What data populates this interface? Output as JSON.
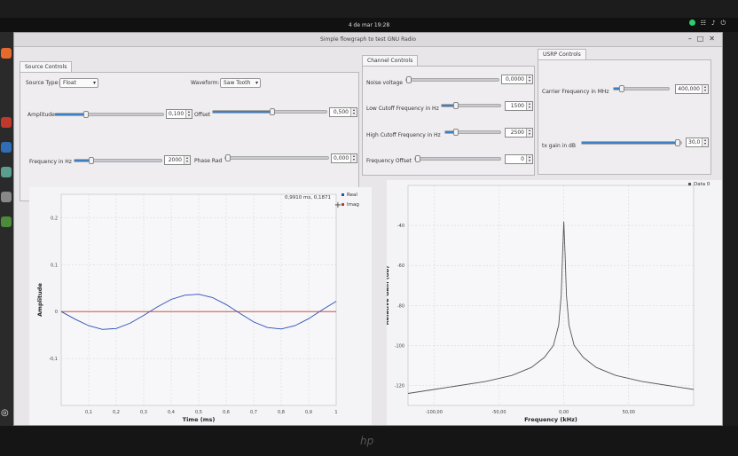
{
  "topbar": {
    "datetime": "4 de mar  19:28"
  },
  "window": {
    "title": "Simple flowgraph to test GNU Radio"
  },
  "source_controls": {
    "tab": "Source Controls",
    "source_type_label": "Source Type:",
    "source_type_value": "Float",
    "waveform_label": "Waveform:",
    "waveform_value": "Saw Tooth",
    "amplitude_label": "Amplitude",
    "amplitude_value": "0,100",
    "offset_label": "Offset",
    "offset_value": "0,500",
    "frequency_label": "Frequency in Hz",
    "frequency_value": "2000",
    "phase_label": "Phase Rad",
    "phase_value": "0,000"
  },
  "channel_controls": {
    "tab": "Channel Controls",
    "noise_label": "Noise voltage",
    "noise_value": "0,0000",
    "low_cutoff_label": "Low Cutoff Frequency in Hz",
    "low_cutoff_value": "1500",
    "high_cutoff_label": "High Cutoff Frequency in Hz",
    "high_cutoff_value": "2500",
    "freq_offset_label": "Frequency Offset",
    "freq_offset_value": "0"
  },
  "usrp_controls": {
    "tab": "USRP Controls",
    "carrier_label": "Carrier Frequency in MHz",
    "carrier_value": "400,000",
    "tx_gain_label": "tx gain in dB",
    "tx_gain_value": "30,0"
  },
  "colors": {
    "accent": "#3d7fc4",
    "real": "#2a4db8",
    "imag": "#c0392b"
  },
  "chart_data": [
    {
      "type": "line",
      "xlabel": "Time (ms)",
      "ylabel": "Amplitude",
      "xticks": [
        "0,1",
        "0,2",
        "0,3",
        "0,4",
        "0,5",
        "0,6",
        "0,7",
        "0,8",
        "0,9",
        "1"
      ],
      "yticks": [
        "0,2",
        "0,1",
        "0",
        "-0,1"
      ],
      "xlim": [
        0,
        1
      ],
      "ylim": [
        -0.2,
        0.25
      ],
      "cursor_readout": "0,9910 ms, 0,1871",
      "grid": true,
      "legend": "top-right",
      "series": [
        {
          "name": "Real",
          "color": "#2a4db8",
          "x": [
            0,
            0.05,
            0.1,
            0.15,
            0.2,
            0.25,
            0.3,
            0.35,
            0.4,
            0.45,
            0.5,
            0.55,
            0.6,
            0.65,
            0.7,
            0.75,
            0.8,
            0.85,
            0.9,
            0.95,
            1.0
          ],
          "y": [
            0,
            -0.016,
            -0.03,
            -0.038,
            -0.036,
            -0.025,
            -0.008,
            0.01,
            0.026,
            0.035,
            0.037,
            0.03,
            0.015,
            -0.004,
            -0.022,
            -0.034,
            -0.037,
            -0.03,
            -0.015,
            0.004,
            0.022
          ]
        },
        {
          "name": "Imag",
          "color": "#c0392b",
          "x": [
            0,
            1
          ],
          "y": [
            0,
            0
          ]
        }
      ]
    },
    {
      "type": "line",
      "xlabel": "Frequency (kHz)",
      "ylabel": "Relative Gain (dB)",
      "xticks": [
        "-100,00",
        "-50,00",
        "0,00",
        "50,00"
      ],
      "yticks": [
        "-40",
        "-60",
        "-80",
        "-100",
        "-120"
      ],
      "xlim": [
        -120,
        100
      ],
      "ylim": [
        -130,
        -20
      ],
      "grid": true,
      "legend": "top-right",
      "series": [
        {
          "name": "Data 0",
          "color": "#555555",
          "x": [
            -120,
            -100,
            -80,
            -60,
            -40,
            -25,
            -15,
            -8,
            -4,
            -2,
            -1,
            0,
            1,
            2,
            4,
            8,
            15,
            25,
            40,
            60,
            80,
            100
          ],
          "y": [
            -124,
            -122,
            -120,
            -118,
            -115,
            -111,
            -106,
            -100,
            -90,
            -75,
            -55,
            -38,
            -55,
            -75,
            -90,
            -100,
            -106,
            -111,
            -115,
            -118,
            -120,
            -122
          ]
        }
      ]
    }
  ]
}
